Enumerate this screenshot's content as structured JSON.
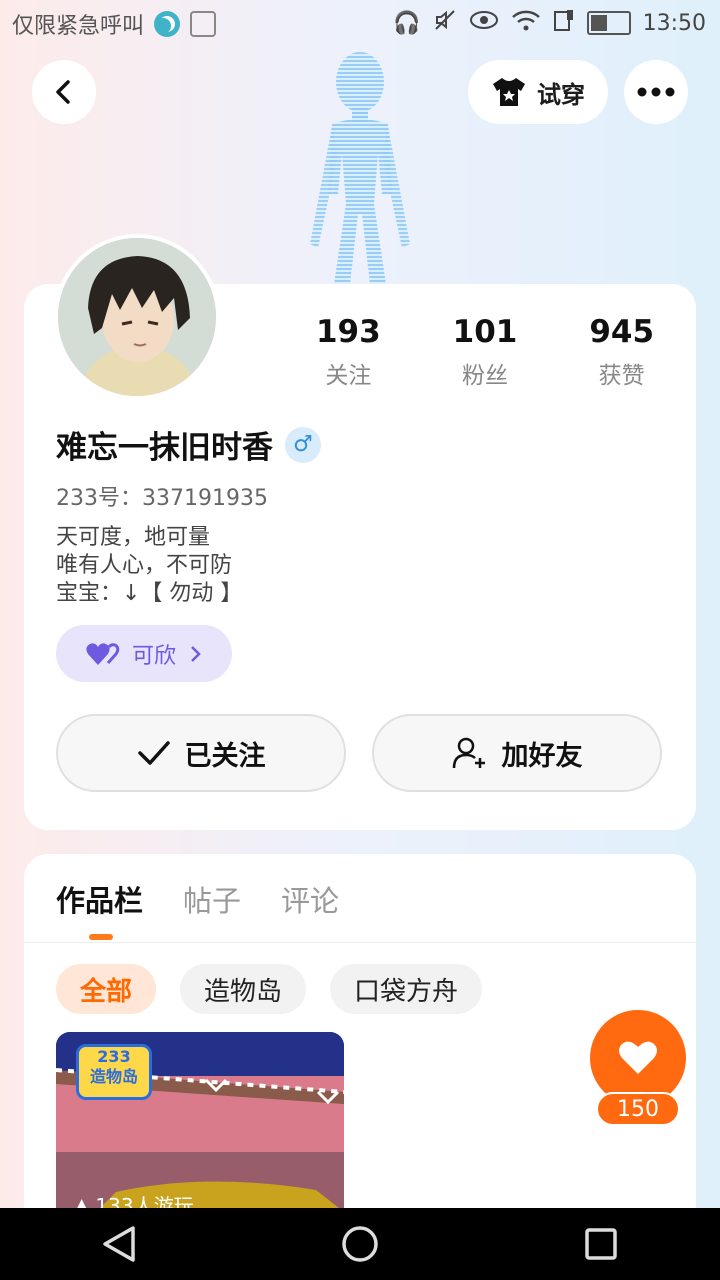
{
  "status_bar": {
    "carrier": "仅限紧急呼叫",
    "time": "13:50"
  },
  "header": {
    "back_icon": "chevron-left-icon",
    "try_on_label": "试穿",
    "try_on_icon": "tshirt-icon",
    "more_icon": "more-dots-icon"
  },
  "profile": {
    "stats": [
      {
        "value": "193",
        "label": "关注"
      },
      {
        "value": "101",
        "label": "粉丝"
      },
      {
        "value": "945",
        "label": "获赞"
      }
    ],
    "name": "难忘一抹旧时香",
    "gender_symbol": "♂",
    "uid": "233号：337191935",
    "bio": [
      "天可度，地可量",
      "唯有人心，不可防",
      "宝宝：↓【 勿动 】"
    ],
    "couple_label": "可欣",
    "follow_button_label": "已关注",
    "add_friend_label": "加好友"
  },
  "works": {
    "tabs": [
      "作品栏",
      "帖子",
      "评论"
    ],
    "active_tab": 0,
    "filters": [
      "全部",
      "造物岛",
      "口袋方舟"
    ],
    "active_filter": 0,
    "thumbnail": {
      "logo_top": "233",
      "logo_bottom": "造物岛",
      "play_count": "133人游玩"
    },
    "like_count": "150"
  },
  "colors": {
    "accent": "#ff6a10",
    "couple_purple": "#6e5ae0",
    "gender_blue": "#2f8fe0"
  }
}
